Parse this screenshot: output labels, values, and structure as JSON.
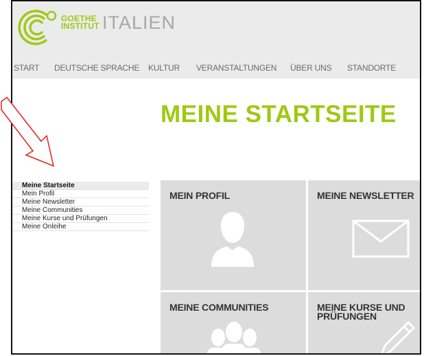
{
  "header": {
    "logo_line1": "GOETHE",
    "logo_line2": "INSTITUT",
    "site_name": "ITALIEN"
  },
  "nav": {
    "items": [
      "START",
      "DEUTSCHE SPRACHE",
      "KULTUR",
      "VERANSTALTUNGEN",
      "ÜBER UNS",
      "STANDORTE"
    ]
  },
  "main": {
    "title": "MEINE STARTSEITE"
  },
  "sidebar": {
    "items": [
      {
        "label": "Meine Startseite",
        "active": true
      },
      {
        "label": "Mein Profil"
      },
      {
        "label": "Meine Newsletter"
      },
      {
        "label": "Meine Communities"
      },
      {
        "label": "Meine Kurse und Prüfungen"
      },
      {
        "label": "Meine Onleihe"
      }
    ]
  },
  "tiles": [
    {
      "title_line1": "MEIN PROFIL",
      "icon": "person-icon"
    },
    {
      "title_line1": "MEINE NEWSLETTER",
      "icon": "envelope-icon"
    },
    {
      "title_line1": "MEINE COMMUNITIES",
      "icon": "group-icon"
    },
    {
      "title_line1": "MEINE KURSE UND",
      "title_line2": "PRÜFUNGEN",
      "icon": "pencil-icon"
    }
  ],
  "colors": {
    "brand_green": "#a0c814",
    "header_bg": "#ebebeb",
    "tile_bg": "#dcdcdc",
    "annotation_arrow": "#e0201b"
  }
}
